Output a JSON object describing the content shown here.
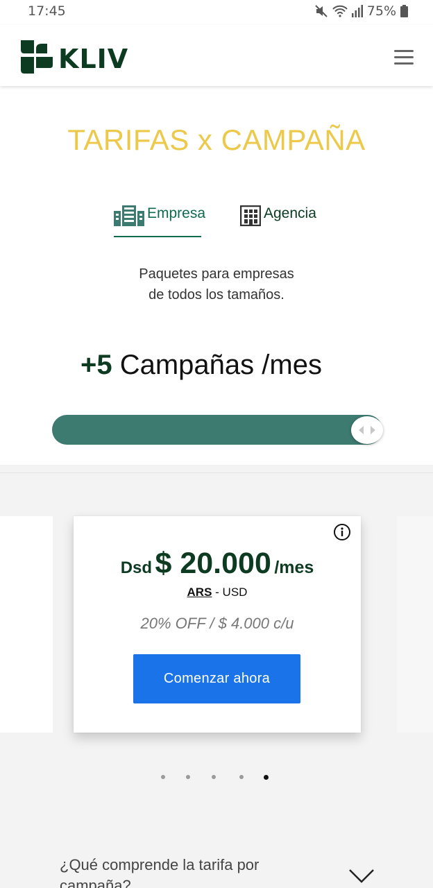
{
  "status_bar": {
    "time": "17:45",
    "battery": "75%",
    "icons": [
      "mute-icon",
      "wifi-icon",
      "signal-icon",
      "battery-icon"
    ]
  },
  "header": {
    "logo_text": "KLIV",
    "menu_icon": "hamburger-menu-icon",
    "brand_color": "#0d3b22"
  },
  "hero": {
    "title": "TARIFAS x CAMPAÑA",
    "title_color": "#ecc94b",
    "tabs": [
      {
        "label": "Empresa",
        "icon": "building-icon",
        "selected": true
      },
      {
        "label": "Agencia",
        "icon": "office-building-icon",
        "selected": false
      }
    ],
    "subtitle_line1": "Paquetes para empresas",
    "subtitle_line2": "de todos los tamaños.",
    "campaigns_count": "+5",
    "campaigns_text": " Campañas /mes",
    "slider_value_fraction": 1.0,
    "slider_color": "#3d7a70"
  },
  "pricing_card": {
    "price_prefix": "Dsd",
    "price_amount": "$ 20.000",
    "price_suffix": "/mes",
    "currency_selected": "ARS",
    "currency_separator": " - ",
    "currency_other": "USD",
    "discount": "20% OFF / $ 4.000 c/u",
    "cta_label": "Comenzar ahora",
    "cta_color": "#1a73e8",
    "info_icon": "info-icon"
  },
  "carousel": {
    "dot_count": 5,
    "active_index": 4
  },
  "faq": {
    "question": "¿Qué comprende la tarifa por campaña?",
    "chevron_icon": "chevron-down-icon"
  }
}
